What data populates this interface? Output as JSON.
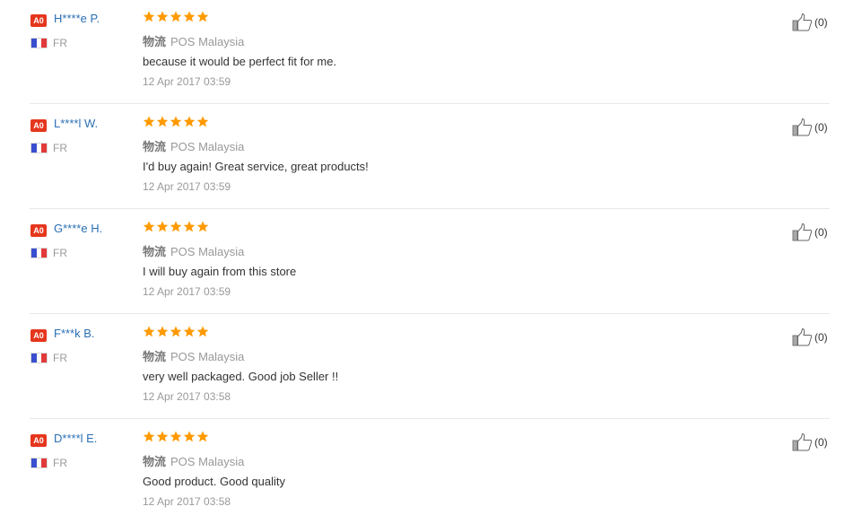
{
  "colors": {
    "accent_link": "#2a6fb3",
    "badge_red": "#e5361d",
    "star_orange": "#ff9a00",
    "flag_blue": "#3a4fcf",
    "flag_red": "#e23a3a"
  },
  "icons": {
    "rating": "star-icon",
    "helpful": "thumbs-up-icon",
    "country_flag": "france-flag-icon"
  },
  "reviews": [
    {
      "badge": "A0",
      "user": "H****e P.",
      "country": "FR",
      "rating": 5,
      "logistics_label": "物流",
      "logistics_value": "POS Malaysia",
      "text": "because it would be perfect fit for me.",
      "date": "12 Apr 2017 03:59",
      "helpful": "(0)"
    },
    {
      "badge": "A0",
      "user": "L****l W.",
      "country": "FR",
      "rating": 5,
      "logistics_label": "物流",
      "logistics_value": "POS Malaysia",
      "text": "I'd buy again! Great service, great products!",
      "date": "12 Apr 2017 03:59",
      "helpful": "(0)"
    },
    {
      "badge": "A0",
      "user": "G****e H.",
      "country": "FR",
      "rating": 5,
      "logistics_label": "物流",
      "logistics_value": "POS Malaysia",
      "text": "I will buy again from this store",
      "date": "12 Apr 2017 03:59",
      "helpful": "(0)"
    },
    {
      "badge": "A0",
      "user": "F***k B.",
      "country": "FR",
      "rating": 5,
      "logistics_label": "物流",
      "logistics_value": "POS Malaysia",
      "text": "very well packaged. Good job Seller !!",
      "date": "12 Apr 2017 03:58",
      "helpful": "(0)"
    },
    {
      "badge": "A0",
      "user": "D****l E.",
      "country": "FR",
      "rating": 5,
      "logistics_label": "物流",
      "logistics_value": "POS Malaysia",
      "text": "Good product. Good quality",
      "date": "12 Apr 2017 03:58",
      "helpful": "(0)"
    }
  ]
}
